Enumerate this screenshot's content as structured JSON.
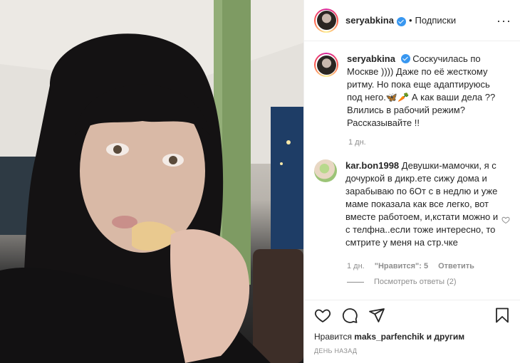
{
  "post": {
    "username": "seryabkina",
    "follow_label": "Подписки",
    "more_label": "···",
    "caption_username": "seryabkina",
    "caption_text": "Соскучилась по Москве )))) Даже по её жесткому ритму. Но пока еще адаптируюсь под него.🦋🥕 А как ваши дела ?? Влились в рабочий режим? Рассказывайте !!",
    "caption_age": "1 дн."
  },
  "comment": {
    "username": "kar.bon1998",
    "text": "Девушки-мамочки, я с дочуркой в дикр.ете сижу дома и зарабываю по 6От с в недлю и уже маме показала как все легко, вот вместе работоем, и,кстати можно и с телфна..если тоже интересно, то смтрите у меня на стр.чке",
    "age": "1 дн.",
    "likes": "\"Нравится\": 5",
    "reply_label": "Ответить",
    "view_replies": "Посмотреть ответы (2)"
  },
  "footer": {
    "likes_prefix": "Нравится",
    "likes_user": "maks_parfenchik",
    "likes_suffix": "и другим",
    "timestamp": "ДЕНЬ НАЗАД"
  },
  "icons": {
    "heart": "heart-icon",
    "comment": "comment-icon",
    "share": "share-icon",
    "bookmark": "bookmark-icon"
  },
  "colors": {
    "verified": "#3897f0",
    "muted": "#8e8e8e",
    "text": "#262626"
  }
}
